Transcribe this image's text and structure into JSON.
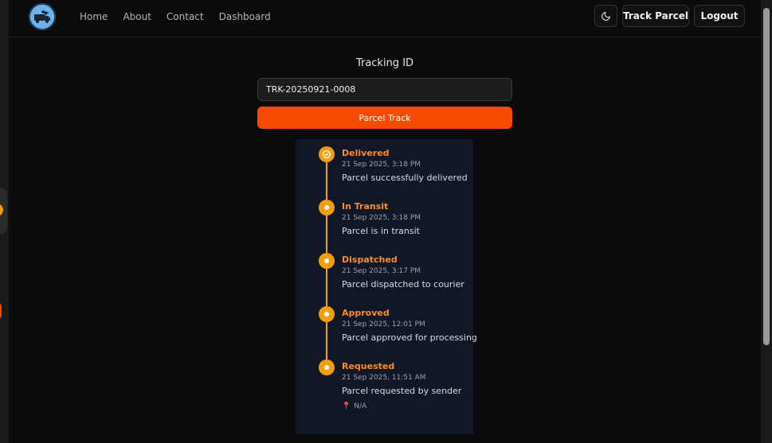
{
  "nav": {
    "links": [
      "Home",
      "About",
      "Contact",
      "Dashboard"
    ],
    "track_parcel": "Track Parcel",
    "logout": "Logout",
    "theme_icon": "moon-icon"
  },
  "tracker": {
    "label": "Tracking ID",
    "input_value": "TRK-20250921-0008",
    "button": "Parcel Track"
  },
  "timeline": [
    {
      "status": "Delivered",
      "time": "21 Sep 2025, 3:18 PM",
      "desc": "Parcel successfully delivered",
      "icon": "check-circle-icon"
    },
    {
      "status": "In Transit",
      "time": "21 Sep 2025, 3:18 PM",
      "desc": "Parcel is in transit",
      "icon": "dot-icon"
    },
    {
      "status": "Dispatched",
      "time": "21 Sep 2025, 3:17 PM",
      "desc": "Parcel dispatched to courier",
      "icon": "dot-icon"
    },
    {
      "status": "Approved",
      "time": "21 Sep 2025, 12:01 PM",
      "desc": "Parcel approved for processing",
      "icon": "dot-icon"
    },
    {
      "status": "Requested",
      "time": "21 Sep 2025, 11:51 AM",
      "desc": "Parcel requested by sender",
      "icon": "dot-icon",
      "location": "N/A"
    }
  ],
  "colors": {
    "accent": "#f54a00",
    "timeline": "#f59e0b",
    "status_text": "#fb8c2b",
    "panel_bg": "#101828"
  }
}
